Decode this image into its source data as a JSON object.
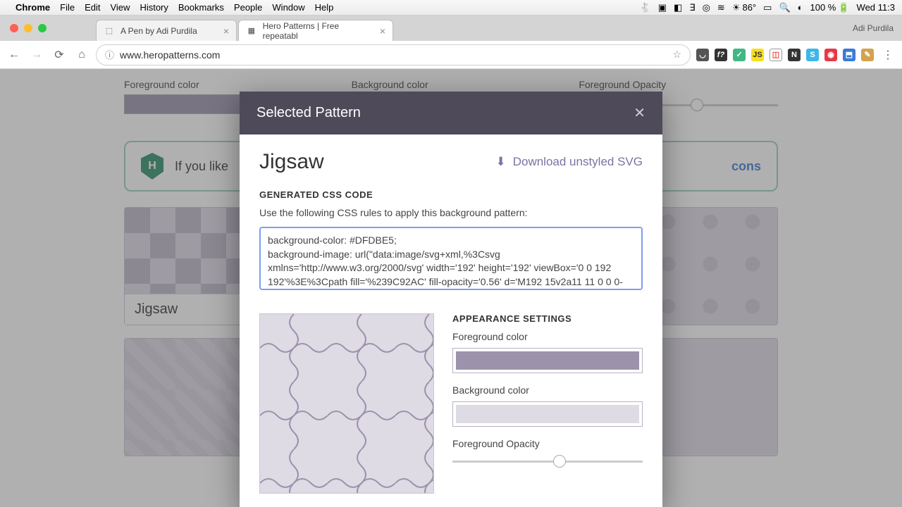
{
  "menubar": {
    "app": "Chrome",
    "items": [
      "File",
      "Edit",
      "View",
      "History",
      "Bookmarks",
      "People",
      "Window",
      "Help"
    ],
    "temp": "86°",
    "battery": "100 %",
    "clock": "Wed 11:3"
  },
  "tabs": [
    {
      "title": "A Pen by Adi Purdila"
    },
    {
      "title": "Hero Patterns | Free repeatabl"
    }
  ],
  "profile": "Adi Purdila",
  "url": "www.heropatterns.com",
  "page": {
    "fg_label": "Foreground color",
    "bg_label": "Background color",
    "op_label": "Foreground Opacity",
    "promo_prefix": "If you like",
    "promo_link": "cons",
    "tile_jigsaw": "Jigsaw"
  },
  "modal": {
    "title": "Selected Pattern",
    "pattern_name": "Jigsaw",
    "download": "Download unstyled SVG",
    "gen_label": "GENERATED CSS CODE",
    "gen_desc": "Use the following CSS rules to apply this background pattern:",
    "code": "background-color: #DFDBE5;\nbackground-image: url(\"data:image/svg+xml,%3Csvg xmlns='http://www.w3.org/2000/svg' width='192' height='192' viewBox='0 0 192 192'%3E%3Cpath fill='%239C92AC' fill-opacity='0.56' d='M192 15v2a11 11 0 0 0-",
    "app_label": "APPEARANCE SETTINGS",
    "fg_label": "Foreground color",
    "bg_label": "Background color",
    "op_label": "Foreground Opacity",
    "colors": {
      "fg": "#9C92AC",
      "bg": "#DFDBE5"
    }
  }
}
